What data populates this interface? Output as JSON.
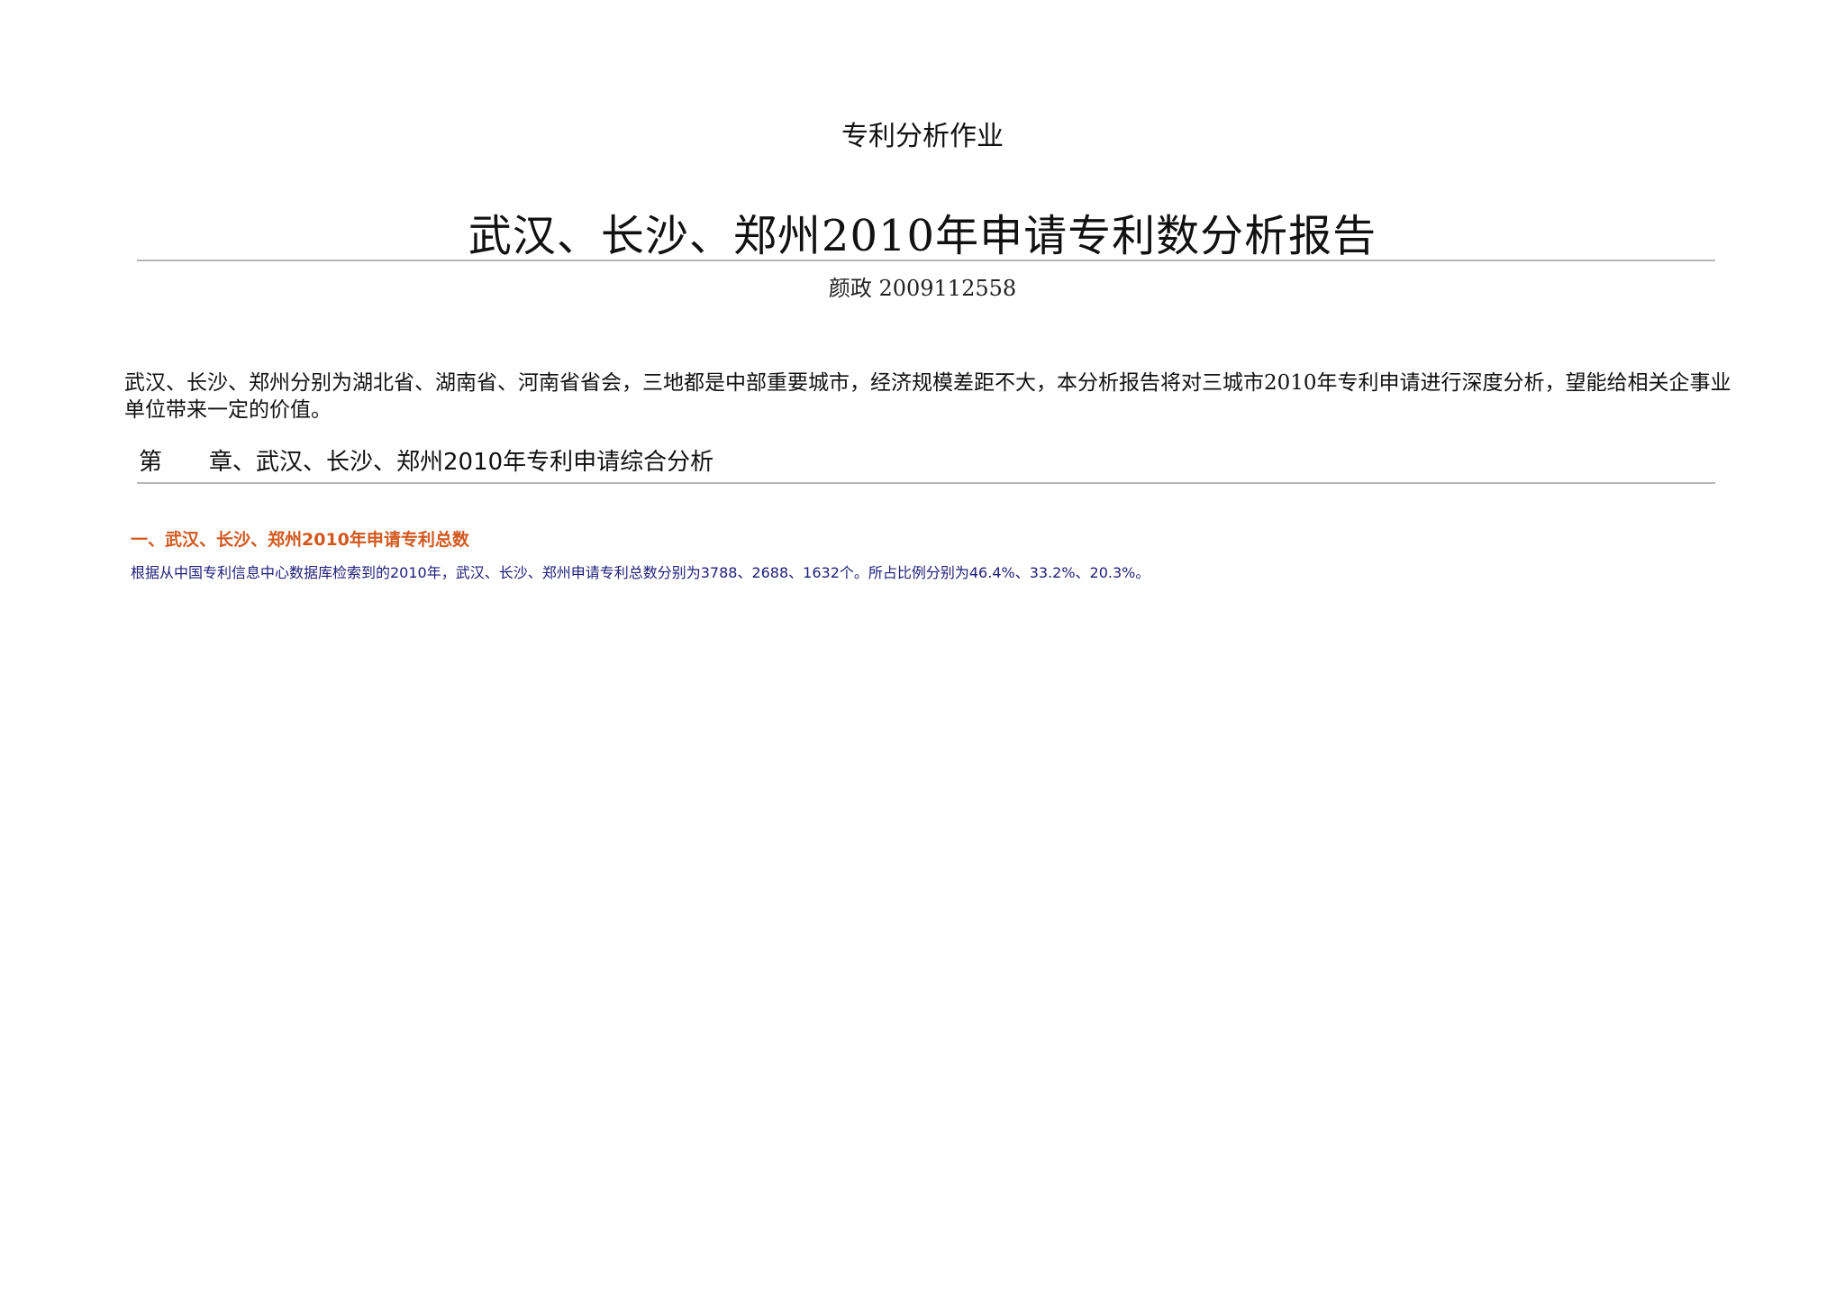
{
  "document": {
    "course_title": "专利分析作业",
    "report_title": "武汉、长沙、郑州2010年申请专利数分析报告",
    "author_line": "颜政 2009112558",
    "intro": "武汉、长沙、郑州分别为湖北省、湖南省、河南省省会，三地都是中部重要城市，经济规模差距不大，本分析报告将对三城市2010年专利申请进行深度分析，望能给相关企事业单位带来一定的价值。",
    "chapter_heading": "第　　章、武汉、长沙、郑州2010年专利申请综合分析",
    "section_heading": "一、武汉、长沙、郑州2010年申请专利总数",
    "section_text": "根据从中国专利信息中心数据库检索到的2010年，武汉、长沙、郑州申请专利总数分别为3788、2688、1632个。所占比例分别为46.4%、33.2%、20.3%。"
  },
  "colors": {
    "section_heading": "#d2581e",
    "section_text": "#1e1e7a",
    "rule": "#b8b8b8"
  }
}
